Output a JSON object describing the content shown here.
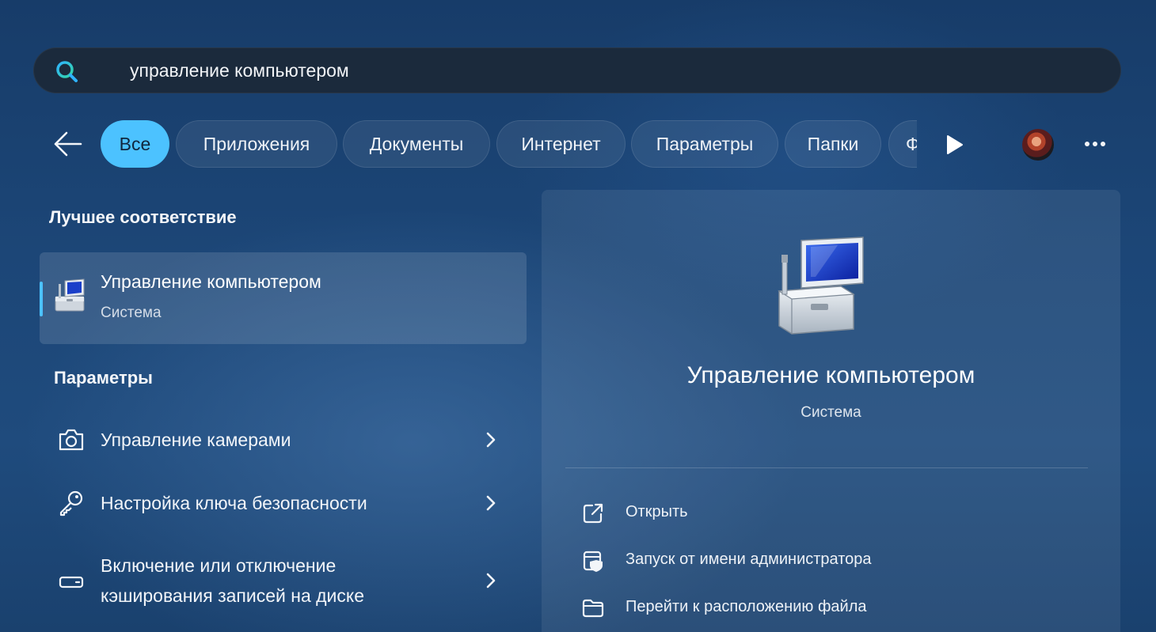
{
  "search": {
    "query": "управление компьютером"
  },
  "filters": {
    "chips": [
      "Все",
      "Приложения",
      "Документы",
      "Интернет",
      "Параметры",
      "Папки",
      "Фотографии"
    ],
    "active": "Все"
  },
  "best_match": {
    "heading": "Лучшее соответствие",
    "title": "Управление компьютером",
    "subtitle": "Система"
  },
  "settings": {
    "heading": "Параметры",
    "items": [
      {
        "label": "Управление камерами",
        "icon": "camera-icon"
      },
      {
        "label": "Настройка ключа безопасности",
        "icon": "key-icon"
      },
      {
        "label_line1": "Включение или отключение",
        "label_line2": "кэширования записей на диске",
        "icon": "drive-icon"
      }
    ]
  },
  "detail": {
    "title": "Управление компьютером",
    "subtitle": "Система",
    "actions": [
      {
        "label": "Открыть",
        "icon": "open-external-icon"
      },
      {
        "label": "Запуск от имени администратора",
        "icon": "admin-shield-icon"
      },
      {
        "label": "Перейти к расположению файла",
        "icon": "folder-icon"
      }
    ]
  },
  "colors": {
    "accent": "#4cc2ff",
    "search_bg": "#1b2a3c"
  }
}
